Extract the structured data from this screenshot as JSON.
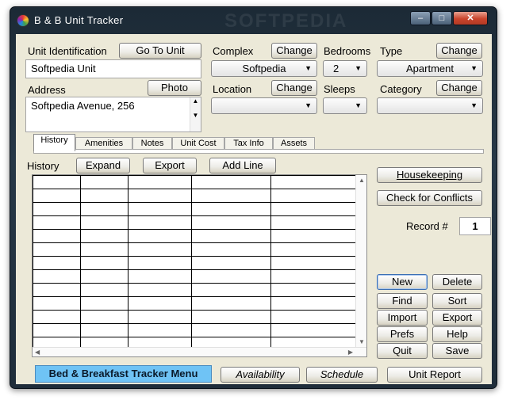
{
  "window": {
    "title": "B & B Unit Tracker",
    "watermark": "SOFTPEDIA",
    "controls": {
      "minimize": "–",
      "maximize": "□",
      "close": "✕"
    }
  },
  "unit": {
    "id_label": "Unit Identification",
    "goto_button": "Go To Unit",
    "id_value": "Softpedia Unit",
    "address_label": "Address",
    "photo_button": "Photo",
    "address_value": "Softpedia Avenue, 256"
  },
  "complex": {
    "label": "Complex",
    "change_button": "Change",
    "value": "Softpedia"
  },
  "bedrooms": {
    "label": "Bedrooms",
    "value": "2"
  },
  "type": {
    "label": "Type",
    "change_button": "Change",
    "value": "Apartment"
  },
  "location": {
    "label": "Location",
    "change_button": "Change",
    "value": ""
  },
  "sleeps": {
    "label": "Sleeps",
    "value": ""
  },
  "category": {
    "label": "Category",
    "change_button": "Change",
    "value": ""
  },
  "tabs": [
    "History",
    "Amenities",
    "Notes",
    "Unit Cost",
    "Tax Info",
    "Assets"
  ],
  "history": {
    "label": "History",
    "expand_button": "Expand",
    "export_button": "Export",
    "add_line_button": "Add Line"
  },
  "side": {
    "housekeeping_button": "Housekeeping",
    "conflicts_button": "Check for Conflicts",
    "record_label": "Record #",
    "record_value": "1",
    "new_button": "New",
    "delete_button": "Delete",
    "find_button": "Find",
    "sort_button": "Sort",
    "import_button": "Import",
    "export_button": "Export",
    "prefs_button": "Prefs",
    "help_button": "Help",
    "quit_button": "Quit",
    "save_button": "Save"
  },
  "bottom": {
    "menu_button": "Bed & Breakfast Tracker Menu",
    "availability_button": "Availability",
    "schedule_button": "Schedule",
    "unit_report_button": "Unit Report"
  },
  "colors": {
    "menu_button": "#6fc3f5",
    "client_bg": "#ece9d8",
    "frame": "#273847"
  }
}
